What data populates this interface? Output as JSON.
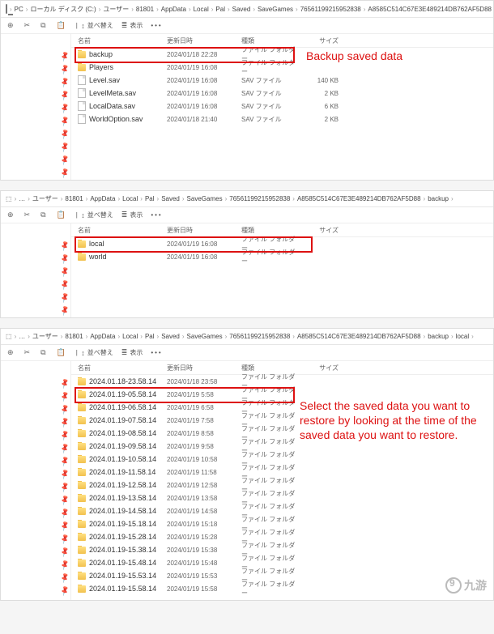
{
  "colors": {
    "highlight": "#d11",
    "folder": "#f2c14e"
  },
  "columns": {
    "name": "名前",
    "date": "更新日時",
    "type": "種類",
    "size": "サイズ"
  },
  "toolbar": {
    "sort": "並べ替え",
    "view": "表示",
    "more": "•••"
  },
  "annotations": {
    "backup": "Backup saved data",
    "restore": "Select the saved data you want to restore by looking at the time of the saved data you want to restore."
  },
  "logo_text": "九游",
  "crumbs": {
    "p1": [
      "PC",
      "ローカル ディスク (C:)",
      "ユーザー",
      "81801",
      "AppData",
      "Local",
      "Pal",
      "Saved",
      "SaveGames",
      "76561199215952838",
      "A8585C514C67E3E489214DB762AF5D88"
    ],
    "p2": [
      "…",
      "ユーザー",
      "81801",
      "AppData",
      "Local",
      "Pal",
      "Saved",
      "SaveGames",
      "76561199215952838",
      "A8585C514C67E3E489214DB762AF5D88",
      "backup"
    ],
    "p3": [
      "…",
      "ユーザー",
      "81801",
      "AppData",
      "Local",
      "Pal",
      "Saved",
      "SaveGames",
      "76561199215952838",
      "A8585C514C67E3E489214DB762AF5D88",
      "backup",
      "local"
    ]
  },
  "files": {
    "p1": [
      {
        "icon": "folder",
        "name": "backup",
        "date": "2024/01/18 22:28",
        "type": "ファイル フォルダー",
        "size": ""
      },
      {
        "icon": "folder",
        "name": "Players",
        "date": "2024/01/19 16:08",
        "type": "ファイル フォルダー",
        "size": ""
      },
      {
        "icon": "file",
        "name": "Level.sav",
        "date": "2024/01/19 16:08",
        "type": "SAV ファイル",
        "size": "140 KB"
      },
      {
        "icon": "file",
        "name": "LevelMeta.sav",
        "date": "2024/01/19 16:08",
        "type": "SAV ファイル",
        "size": "2 KB"
      },
      {
        "icon": "file",
        "name": "LocalData.sav",
        "date": "2024/01/19 16:08",
        "type": "SAV ファイル",
        "size": "6 KB"
      },
      {
        "icon": "file",
        "name": "WorldOption.sav",
        "date": "2024/01/18 21:40",
        "type": "SAV ファイル",
        "size": "2 KB"
      }
    ],
    "p2": [
      {
        "icon": "folder",
        "name": "local",
        "date": "2024/01/19 16:08",
        "type": "ファイル フォルダー",
        "size": ""
      },
      {
        "icon": "folder",
        "name": "world",
        "date": "2024/01/19 16:08",
        "type": "ファイル フォルダー",
        "size": ""
      }
    ],
    "p3": [
      {
        "icon": "folder",
        "name": "2024.01.18-23.58.14",
        "date": "2024/01/18 23:58",
        "type": "ファイル フォルダー",
        "size": ""
      },
      {
        "icon": "folder",
        "name": "2024.01.19-05.58.14",
        "date": "2024/01/19 5:58",
        "type": "ファイル フォルダー",
        "size": ""
      },
      {
        "icon": "folder",
        "name": "2024.01.19-06.58.14",
        "date": "2024/01/19 6:58",
        "type": "ファイル フォルダー",
        "size": ""
      },
      {
        "icon": "folder",
        "name": "2024.01.19-07.58.14",
        "date": "2024/01/19 7:58",
        "type": "ファイル フォルダー",
        "size": ""
      },
      {
        "icon": "folder",
        "name": "2024.01.19-08.58.14",
        "date": "2024/01/19 8:58",
        "type": "ファイル フォルダー",
        "size": ""
      },
      {
        "icon": "folder",
        "name": "2024.01.19-09.58.14",
        "date": "2024/01/19 9:58",
        "type": "ファイル フォルダー",
        "size": ""
      },
      {
        "icon": "folder",
        "name": "2024.01.19-10.58.14",
        "date": "2024/01/19 10:58",
        "type": "ファイル フォルダー",
        "size": ""
      },
      {
        "icon": "folder",
        "name": "2024.01.19-11.58.14",
        "date": "2024/01/19 11:58",
        "type": "ファイル フォルダー",
        "size": ""
      },
      {
        "icon": "folder",
        "name": "2024.01.19-12.58.14",
        "date": "2024/01/19 12:58",
        "type": "ファイル フォルダー",
        "size": ""
      },
      {
        "icon": "folder",
        "name": "2024.01.19-13.58.14",
        "date": "2024/01/19 13:58",
        "type": "ファイル フォルダー",
        "size": ""
      },
      {
        "icon": "folder",
        "name": "2024.01.19-14.58.14",
        "date": "2024/01/19 14:58",
        "type": "ファイル フォルダー",
        "size": ""
      },
      {
        "icon": "folder",
        "name": "2024.01.19-15.18.14",
        "date": "2024/01/19 15:18",
        "type": "ファイル フォルダー",
        "size": ""
      },
      {
        "icon": "folder",
        "name": "2024.01.19-15.28.14",
        "date": "2024/01/19 15:28",
        "type": "ファイル フォルダー",
        "size": ""
      },
      {
        "icon": "folder",
        "name": "2024.01.19-15.38.14",
        "date": "2024/01/19 15:38",
        "type": "ファイル フォルダー",
        "size": ""
      },
      {
        "icon": "folder",
        "name": "2024.01.19-15.48.14",
        "date": "2024/01/19 15:48",
        "type": "ファイル フォルダー",
        "size": ""
      },
      {
        "icon": "folder",
        "name": "2024.01.19-15.53.14",
        "date": "2024/01/19 15:53",
        "type": "ファイル フォルダー",
        "size": ""
      },
      {
        "icon": "folder",
        "name": "2024.01.19-15.58.14",
        "date": "2024/01/19 15:58",
        "type": "ファイル フォルダー",
        "size": ""
      }
    ]
  }
}
